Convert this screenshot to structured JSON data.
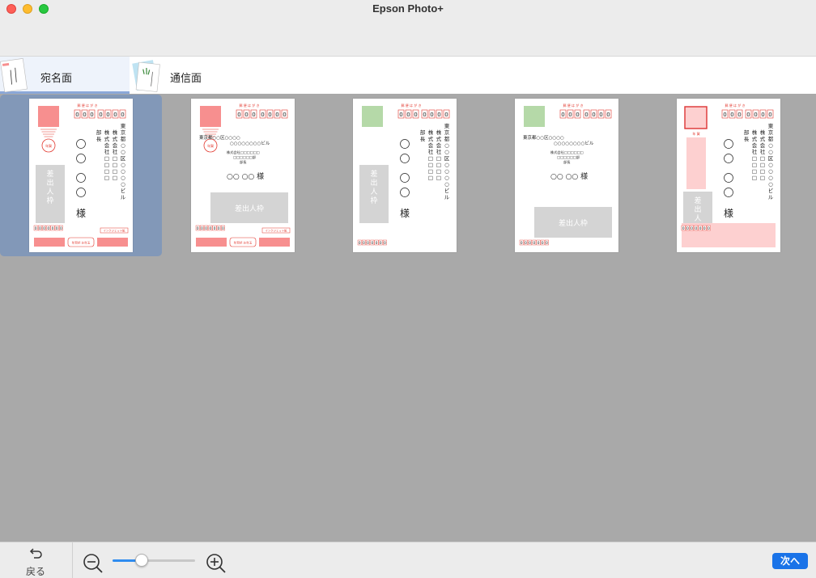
{
  "window": {
    "title": "Epson Photo+"
  },
  "tabs": [
    {
      "label": "宛名面",
      "selected": true
    },
    {
      "label": "通信面",
      "selected": false
    }
  ],
  "templates": [
    {
      "stamp_color": "#f78f8f",
      "red_circle": true,
      "vertical_address": true,
      "sender_label": "差出人枠",
      "sender_box": "left",
      "bottom_bar": true,
      "honorific": "様",
      "selected": true,
      "stamp_label": "年賀",
      "postal_label": "郵 便 は が き",
      "postal_code": "0000000",
      "sender_postal": "0000000",
      "bottom_badge": "年賀状 お年玉",
      "logo_text": "インクジェット紙",
      "recipient_lines": [
        "東 京 都 ○ ○ 区 ○ ○ ○ ○ ビ ル",
        "株 式 会 社 □ □ □ □",
        "部 長"
      ]
    },
    {
      "stamp_color": "#f78f8f",
      "red_circle": true,
      "vertical_address": false,
      "sender_label": "差出人枠",
      "sender_box": "center",
      "bottom_bar": true,
      "honorific": "○○ ○○ 様",
      "selected": false,
      "stamp_label": "年賀",
      "postal_label": "郵 便 は が き",
      "postal_code": "0000000",
      "sender_postal": "0000000",
      "bottom_badge": "年賀状 お年玉",
      "logo_text": "インクジェット紙",
      "recipient_lines": [
        "東京都○○区○○○○",
        "○○○○○○○○ビル",
        "株式会社□□□□□□",
        "□□□□□□部",
        "部長"
      ]
    },
    {
      "stamp_color": "#b5d9a8",
      "red_circle": false,
      "vertical_address": true,
      "sender_label": "差出人枠",
      "sender_box": "left",
      "bottom_bar": false,
      "honorific": "様",
      "selected": false,
      "stamp_label": "",
      "postal_label": "郵 便 は が き",
      "postal_code": "0000000",
      "sender_postal": "0000000",
      "bottom_badge": "",
      "logo_text": "",
      "recipient_lines": [
        "東 京 都 ○ ○ 区 ○ ○ ○ ○ ビ ル",
        "株 式 会 社 □ □ □ □",
        "部 長"
      ]
    },
    {
      "stamp_color": "#b5d9a8",
      "red_circle": false,
      "vertical_address": false,
      "sender_label": "差出人枠",
      "sender_box": "center",
      "bottom_bar": false,
      "honorific": "○○ ○○ 様",
      "selected": false,
      "stamp_label": "",
      "postal_label": "郵 便 は が き",
      "postal_code": "0000000",
      "sender_postal": "0000000",
      "bottom_badge": "",
      "logo_text": "",
      "recipient_lines": [
        "東京都○○区○○○○",
        "○○○○○○○○ビル",
        "株式会社□□□□□□",
        "□□□□□□部",
        "部長"
      ]
    },
    {
      "stamp_color": "#fdd0d0",
      "red_circle": false,
      "vertical_address": true,
      "sender_label": "差出人枠",
      "sender_box": "left",
      "bottom_bar": false,
      "honorific": "様",
      "selected": false,
      "stamp_label": "",
      "postal_label": "郵 便 は が き",
      "postal_code": "0000000",
      "sender_postal": "0000000",
      "bottom_badge": "",
      "logo_text": "",
      "under_stamp_label": "年 賀",
      "recipient_lines": [
        "東 京 都 ○ ○ 区 ○ ○ ○ ○ ビ ル",
        "株 式 会 社 □ □ □ □",
        "部 長"
      ]
    }
  ],
  "footer": {
    "back_label": "戻る",
    "next_label": "次へ",
    "zoom_level": 0.35
  },
  "colors": {
    "accent": "#1a73e8",
    "selection": "#8298b8",
    "postal_red": "#e2382e",
    "pink": "#f78f8f",
    "green": "#b5d9a8",
    "sender_gray": "#d4d4d4"
  }
}
